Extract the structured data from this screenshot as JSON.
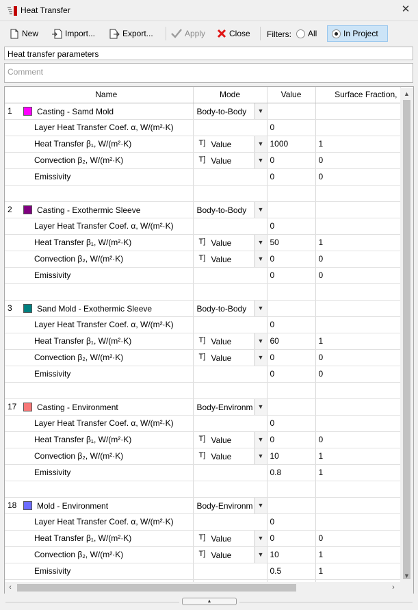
{
  "window": {
    "title": "Heat Transfer",
    "close_glyph": "✕"
  },
  "toolbar": {
    "new_label": "New",
    "import_label": "Import...",
    "export_label": "Export...",
    "apply_label": "Apply",
    "close_label": "Close",
    "filters_label": "Filters:",
    "all_label": "All",
    "in_project_label": "In Project",
    "selected_filter": "In Project"
  },
  "form": {
    "name_value": "Heat transfer parameters",
    "comment_placeholder": "Comment"
  },
  "grid": {
    "columns": [
      "Name",
      "Mode",
      "Value",
      "Surface Fraction,"
    ],
    "groups": [
      {
        "num": "1",
        "name": "Casting - Samd Mold",
        "color": "#ff00ff",
        "mode": "Body-to-Body",
        "rows": [
          {
            "label": "Layer Heat Transfer Coef. α, W/(m²·K)",
            "mode": "",
            "value": "0",
            "fraction": ""
          },
          {
            "label": "Heat Transfer β₁, W/(m²·K)",
            "mode": "Value",
            "value": "1000",
            "fraction": "1"
          },
          {
            "label": "Convection β₂, W/(m²·K)",
            "mode": "Value",
            "value": "0",
            "fraction": "0"
          },
          {
            "label": "Emissivity",
            "mode": "",
            "value": "0",
            "fraction": "0"
          }
        ]
      },
      {
        "num": "2",
        "name": "Casting - Exothermic Sleeve",
        "color": "#800080",
        "mode": "Body-to-Body",
        "rows": [
          {
            "label": "Layer Heat Transfer Coef. α, W/(m²·K)",
            "mode": "",
            "value": "0",
            "fraction": ""
          },
          {
            "label": "Heat Transfer β₁, W/(m²·K)",
            "mode": "Value",
            "value": "50",
            "fraction": "1"
          },
          {
            "label": "Convection β₂, W/(m²·K)",
            "mode": "Value",
            "value": "0",
            "fraction": "0"
          },
          {
            "label": "Emissivity",
            "mode": "",
            "value": "0",
            "fraction": "0"
          }
        ]
      },
      {
        "num": "3",
        "name": "Sand Mold - Exothermic Sleeve",
        "color": "#008080",
        "mode": "Body-to-Body",
        "rows": [
          {
            "label": "Layer Heat Transfer Coef. α, W/(m²·K)",
            "mode": "",
            "value": "0",
            "fraction": ""
          },
          {
            "label": "Heat Transfer β₁, W/(m²·K)",
            "mode": "Value",
            "value": "60",
            "fraction": "1"
          },
          {
            "label": "Convection β₂, W/(m²·K)",
            "mode": "Value",
            "value": "0",
            "fraction": "0"
          },
          {
            "label": "Emissivity",
            "mode": "",
            "value": "0",
            "fraction": "0"
          }
        ]
      },
      {
        "num": "17",
        "name": "Casting - Environment",
        "color": "#f87878",
        "mode": "Body-Environm",
        "rows": [
          {
            "label": "Layer Heat Transfer Coef. α, W/(m²·K)",
            "mode": "",
            "value": "0",
            "fraction": ""
          },
          {
            "label": "Heat Transfer β₁, W/(m²·K)",
            "mode": "Value",
            "value": "0",
            "fraction": "0"
          },
          {
            "label": "Convection β₂, W/(m²·K)",
            "mode": "Value",
            "value": "10",
            "fraction": "1"
          },
          {
            "label": "Emissivity",
            "mode": "",
            "value": "0.8",
            "fraction": "1"
          }
        ]
      },
      {
        "num": "18",
        "name": "Mold - Environment",
        "color": "#6c6cff",
        "mode": "Body-Environm",
        "rows": [
          {
            "label": "Layer Heat Transfer Coef. α, W/(m²·K)",
            "mode": "",
            "value": "0",
            "fraction": ""
          },
          {
            "label": "Heat Transfer β₁, W/(m²·K)",
            "mode": "Value",
            "value": "0",
            "fraction": "0"
          },
          {
            "label": "Convection β₂, W/(m²·K)",
            "mode": "Value",
            "value": "10",
            "fraction": "1"
          },
          {
            "label": "Emissivity",
            "mode": "",
            "value": "0.5",
            "fraction": "1"
          }
        ]
      }
    ]
  }
}
